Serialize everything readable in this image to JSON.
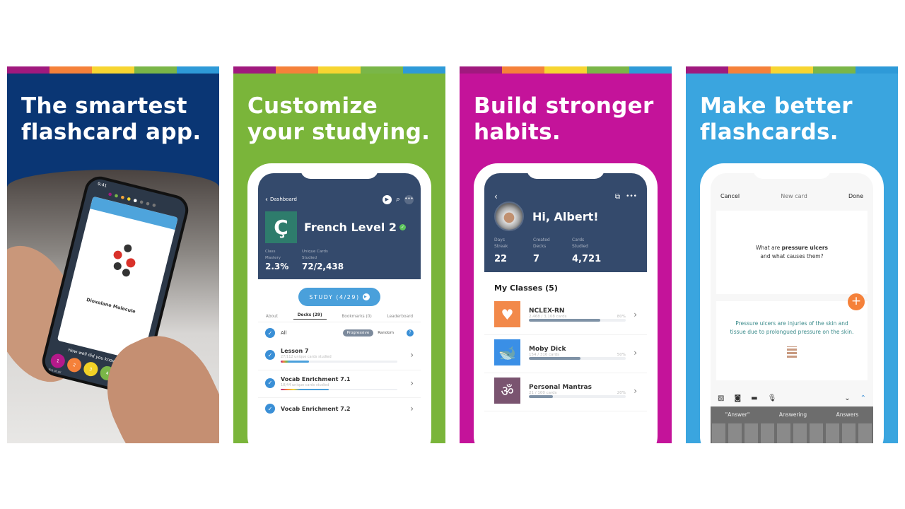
{
  "strip_colors": [
    "#a0197e",
    "#f5813a",
    "#f7d531",
    "#7ab648",
    "#2e9ad8"
  ],
  "panels": [
    {
      "headline": [
        "The smartest",
        "flashcard app."
      ],
      "bg": "#0a3674",
      "phone": {
        "time": "9:41",
        "card_title": "Dioxolane Molecule",
        "prompt": "How well did you know this?",
        "ratings": [
          "1",
          "2",
          "3",
          "4"
        ],
        "rating_colors": [
          "#b5198b",
          "#f5813a",
          "#f2d126",
          "#7ab648"
        ],
        "rating_caption": "Not at all"
      }
    },
    {
      "headline": [
        "Customize",
        "your studying."
      ],
      "bg": "#7ab53a",
      "phone": {
        "back": "Dashboard",
        "class_icon": "Ç",
        "class_title": "French Level 2",
        "stats": [
          {
            "label": "Class Mastery",
            "value": "2.3%"
          },
          {
            "label": "Unique Cards Studied",
            "value": "72/2,438"
          }
        ],
        "study_button": "STUDY (4/29)",
        "tabs": [
          "About",
          "Decks (29)",
          "Bookmarks (0)",
          "Leaderboard"
        ],
        "all_label": "All",
        "modes": [
          "Progressive",
          "Random"
        ],
        "help": "?",
        "decks": [
          {
            "name": "Lesson 7",
            "sub": "27/112 unique cards studied",
            "progress": 24
          },
          {
            "name": "Vocab Enrichment 7.1",
            "sub": "18/44 unique cards studied",
            "progress": 41
          },
          {
            "name": "Vocab Enrichment 7.2",
            "sub": "",
            "progress": 0
          }
        ]
      }
    },
    {
      "headline": [
        "Build stronger",
        "habits."
      ],
      "bg": "#c4139a",
      "phone": {
        "greeting": "Hi, Albert!",
        "stats": [
          {
            "label": "Days Streak",
            "value": "22"
          },
          {
            "label": "Created Decks",
            "value": "7"
          },
          {
            "label": "Cards Studied",
            "value": "4,721"
          }
        ],
        "section": "My Classes (5)",
        "classes": [
          {
            "name": "NCLEX-RN",
            "sub": "2,468 / 3,108 cards",
            "pct": "80%",
            "progress": 74,
            "color": "#f2894a",
            "icon": "heart-pulse-icon",
            "glyph": "♥"
          },
          {
            "name": "Moby Dick",
            "sub": "154 / 316 cards",
            "pct": "50%",
            "progress": 53,
            "color": "#3a8fe6",
            "icon": "whale-icon",
            "glyph": "🐋"
          },
          {
            "name": "Personal Mantras",
            "sub": "21 / 100 cards",
            "pct": "20%",
            "progress": 25,
            "color": "#7a5470",
            "icon": "om-icon",
            "glyph": "ॐ"
          }
        ]
      }
    },
    {
      "headline": [
        "Make better",
        "flashcards."
      ],
      "bg": "#3aa5df",
      "phone": {
        "cancel": "Cancel",
        "title": "New card",
        "done": "Done",
        "question_pre": "What are ",
        "question_bold": "pressure ulcers",
        "question_post": "and what causes them?",
        "answer": "Pressure ulcers are injuries of the skin and tissue due to prolongued pressure on the skin.",
        "suggestions": [
          "\"Answer\"",
          "Answering",
          "Answers"
        ]
      }
    }
  ]
}
